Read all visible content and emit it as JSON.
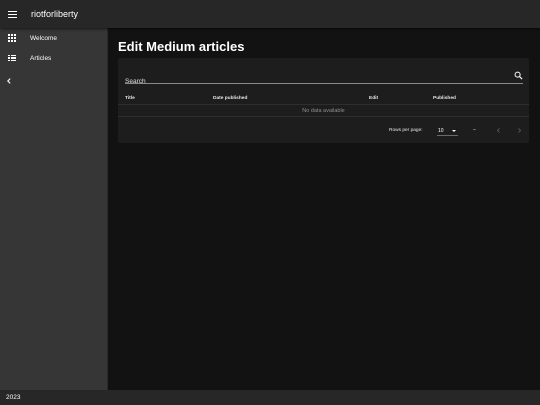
{
  "appbar": {
    "title": "riotforliberty"
  },
  "drawer": {
    "items": [
      {
        "label": "Welcome",
        "icon": "apps-grid-icon"
      },
      {
        "label": "Articles",
        "icon": "list-icon"
      }
    ],
    "collapse_icon": "chevron-left-icon"
  },
  "main": {
    "title": "Edit Medium articles",
    "search": {
      "placeholder": "Search",
      "value": ""
    },
    "table": {
      "columns": [
        "Title",
        "Date published",
        "Edit",
        "Published"
      ],
      "empty_text": "No data available"
    },
    "pagination": {
      "rows_per_page_label": "Rows per page:",
      "rows_per_page": "10",
      "range_text": "–"
    }
  },
  "footer": {
    "text": "2023"
  },
  "colors": {
    "background": "#121212",
    "appbar": "#272727",
    "drawer": "#363636",
    "card": "#1d1d1d"
  }
}
